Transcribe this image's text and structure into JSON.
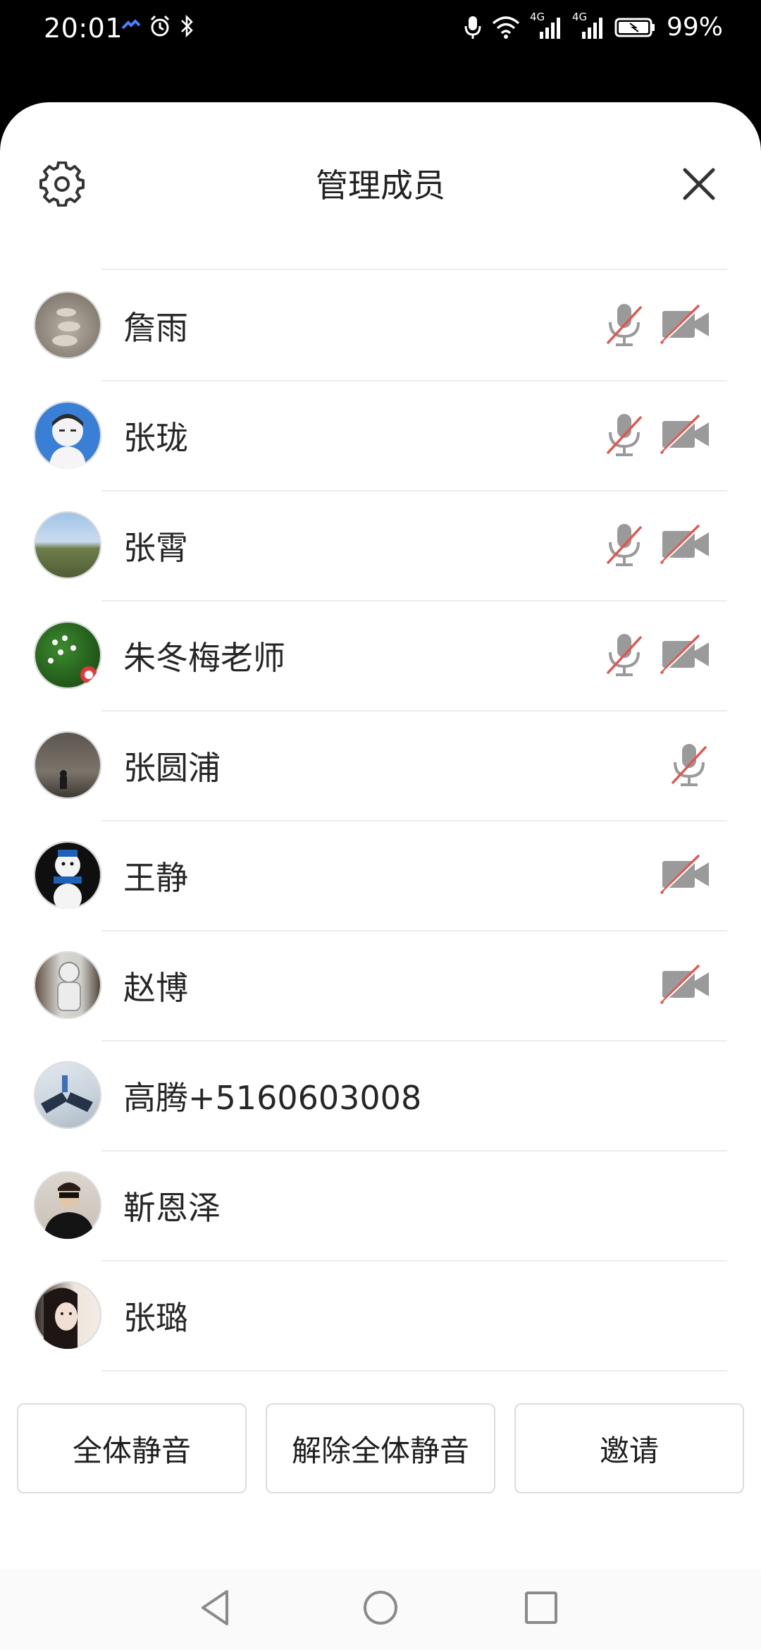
{
  "status_bar": {
    "time": "20:01",
    "battery": "99%",
    "signal_labels": [
      "4G",
      "4G"
    ]
  },
  "header": {
    "title": "管理成员",
    "settings_icon": "gear-icon",
    "close_icon": "close-icon"
  },
  "members": [
    {
      "name": "詹雨",
      "mic_muted": true,
      "camera_off": true
    },
    {
      "name": "张珑",
      "mic_muted": true,
      "camera_off": true
    },
    {
      "name": "张霄",
      "mic_muted": true,
      "camera_off": true
    },
    {
      "name": "朱冬梅老师",
      "mic_muted": true,
      "camera_off": true
    },
    {
      "name": "张圆浦",
      "mic_muted": true,
      "camera_off": false
    },
    {
      "name": "王静",
      "mic_muted": false,
      "camera_off": true
    },
    {
      "name": "赵博",
      "mic_muted": false,
      "camera_off": true
    },
    {
      "name": "高腾+5160603008",
      "mic_muted": false,
      "camera_off": false
    },
    {
      "name": "靳恩泽",
      "mic_muted": false,
      "camera_off": false
    },
    {
      "name": "张璐",
      "mic_muted": false,
      "camera_off": false
    }
  ],
  "buttons": {
    "mute_all": "全体静音",
    "unmute_all": "解除全体静音",
    "invite": "邀请"
  },
  "nav": {
    "back_icon": "back-triangle-icon",
    "home_icon": "home-circle-icon",
    "recents_icon": "recents-square-icon"
  },
  "colors": {
    "mute_slash": "#e0564f",
    "icon_gray": "#9a9a9a"
  }
}
